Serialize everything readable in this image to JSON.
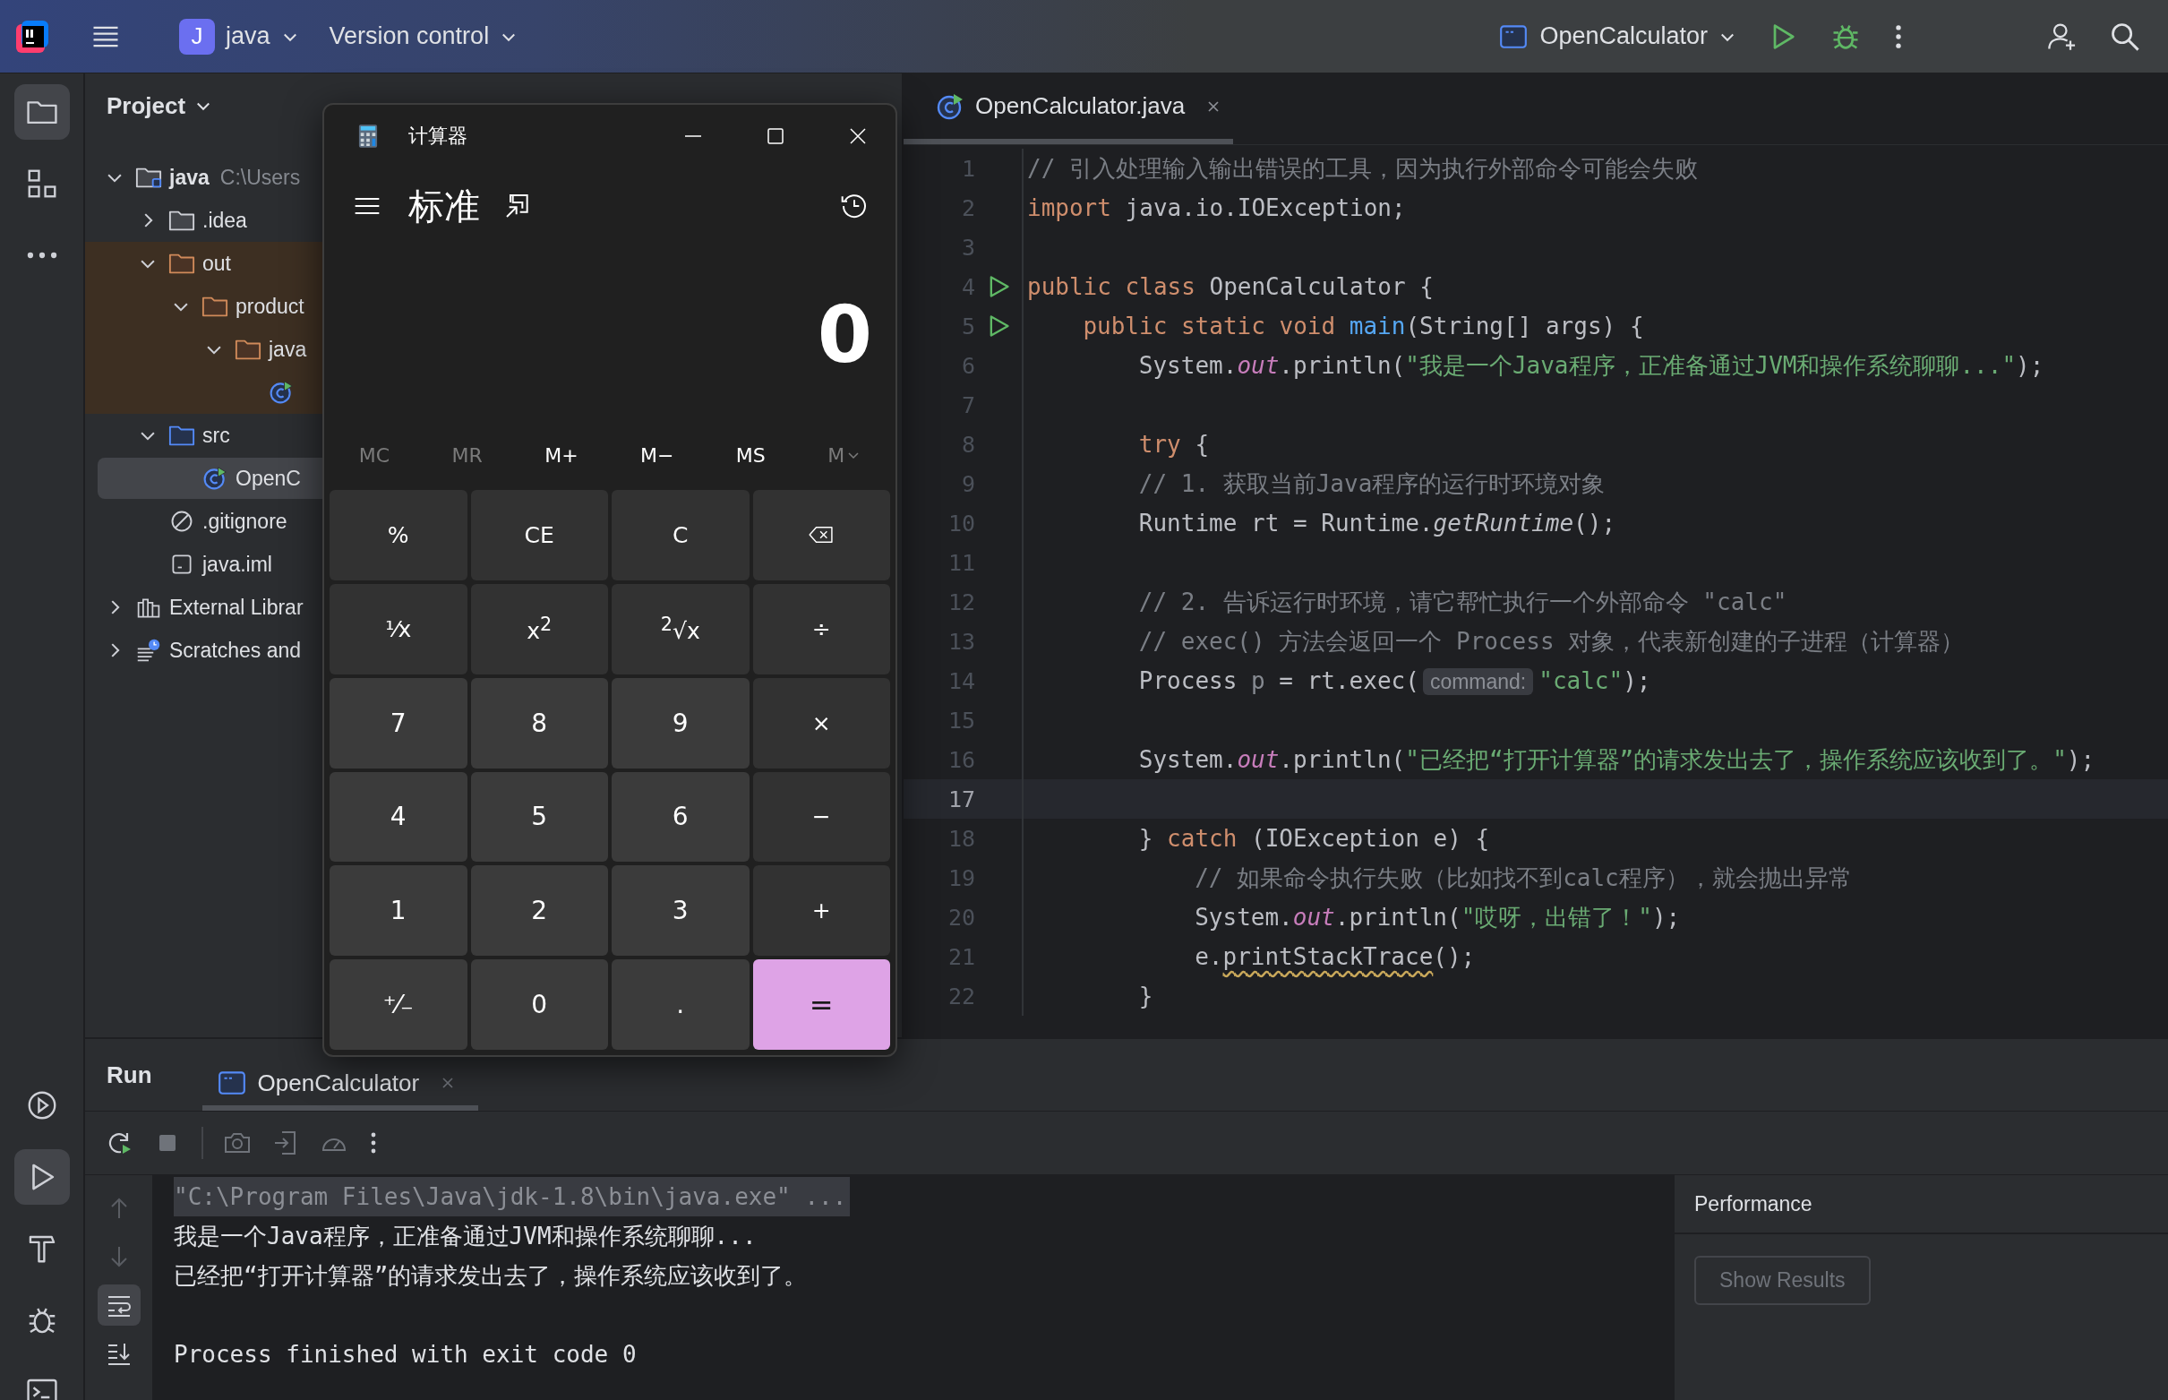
{
  "topbar": {
    "project": {
      "badge": "J",
      "name": "java"
    },
    "vcs": "Version control",
    "run_config": "OpenCalculator"
  },
  "tool_strip": {
    "top": [
      {
        "kind": "project",
        "selected": true
      },
      {
        "kind": "structure",
        "selected": false
      },
      {
        "kind": "more",
        "selected": false
      }
    ],
    "bottom": [
      {
        "kind": "services",
        "selected": false
      },
      {
        "kind": "run",
        "selected": true
      },
      {
        "kind": "build",
        "selected": false
      },
      {
        "kind": "debug",
        "selected": false
      },
      {
        "kind": "terminal",
        "selected": false
      }
    ]
  },
  "project": {
    "title": "Project",
    "tree": [
      {
        "name": "java",
        "path": "C:\\Users",
        "kind": "module",
        "expanded": true,
        "selected": false,
        "children": [
          {
            "name": ".idea",
            "kind": "folder",
            "expanded": false,
            "selected": false
          },
          {
            "name": "out",
            "kind": "excluded",
            "expanded": true,
            "selected": false,
            "children": [
              {
                "name": "product",
                "kind": "excluded",
                "expanded": true,
                "selected": false,
                "children": [
                  {
                    "name": "java",
                    "kind": "excluded",
                    "expanded": true,
                    "selected": false,
                    "children": [
                      {
                        "kind": "class",
                        "selected": false
                      }
                    ]
                  }
                ]
              }
            ]
          },
          {
            "name": "src",
            "kind": "source",
            "expanded": true,
            "selected": false,
            "children": [
              {
                "name": "OpenC",
                "kind": "class",
                "selected": true
              }
            ]
          },
          {
            "name": ".gitignore",
            "kind": "ignore",
            "selected": false
          },
          {
            "name": "java.iml",
            "kind": "iml",
            "selected": false
          }
        ]
      },
      {
        "name": "External Librar",
        "kind": "libraries",
        "expanded": false,
        "selected": false
      },
      {
        "name": "Scratches and",
        "kind": "scratches",
        "expanded": false,
        "selected": false
      }
    ]
  },
  "calculator": {
    "title": "计算器",
    "mode": "标准",
    "display": "0",
    "memory": [
      {
        "label": "MC",
        "kind": "plain",
        "disabled": true
      },
      {
        "label": "MR",
        "kind": "plain",
        "disabled": true
      },
      {
        "label": "M+",
        "kind": "plain",
        "disabled": false
      },
      {
        "label": "M−",
        "kind": "plain",
        "disabled": false
      },
      {
        "label": "MS",
        "kind": "plain",
        "disabled": false
      },
      {
        "label": "M",
        "kind": "dropdown",
        "disabled": true
      }
    ],
    "keys": [
      {
        "label": "%",
        "kind": "op"
      },
      {
        "label": "CE",
        "kind": "op"
      },
      {
        "label": "C",
        "kind": "op"
      },
      {
        "kind": "backspace"
      },
      {
        "label": "¹⁄x",
        "kind": "op"
      },
      {
        "label": "x$^{2}$",
        "kind": "op"
      },
      {
        "label": "$^{2}$√x",
        "kind": "op"
      },
      {
        "label": "÷",
        "kind": "op"
      },
      {
        "label": "7",
        "kind": "digit"
      },
      {
        "label": "8",
        "kind": "digit"
      },
      {
        "label": "9",
        "kind": "digit"
      },
      {
        "label": "×",
        "kind": "op"
      },
      {
        "label": "4",
        "kind": "digit"
      },
      {
        "label": "5",
        "kind": "digit"
      },
      {
        "label": "6",
        "kind": "digit"
      },
      {
        "label": "−",
        "kind": "op"
      },
      {
        "label": "1",
        "kind": "digit"
      },
      {
        "label": "2",
        "kind": "digit"
      },
      {
        "label": "3",
        "kind": "digit"
      },
      {
        "label": "+",
        "kind": "op"
      },
      {
        "label": "⁺⁄₋",
        "kind": "digit"
      },
      {
        "label": "0",
        "kind": "digit"
      },
      {
        "label": ".",
        "kind": "digit"
      },
      {
        "label": "=",
        "kind": "accent"
      }
    ]
  },
  "editor": {
    "tabs": [
      {
        "label": "OpenCalculator.java",
        "selected": true
      }
    ],
    "lines": [
      {
        "number": "1",
        "run": false,
        "current": false,
        "tokens": [
          {
            "kind": "comment",
            "text": "// 引入处理输入输出错误的工具，因为执行外部命令可能会失败"
          }
        ]
      },
      {
        "number": "2",
        "run": false,
        "current": false,
        "tokens": [
          {
            "kind": "kw",
            "text": "import "
          },
          {
            "kind": "plain",
            "text": "java.io.IOException;"
          }
        ]
      },
      {
        "number": "3",
        "run": false,
        "current": false
      },
      {
        "number": "4",
        "run": true,
        "current": false,
        "tokens": [
          {
            "kind": "kw",
            "text": "public class "
          },
          {
            "kind": "plain",
            "text": "OpenCalculator {"
          }
        ]
      },
      {
        "number": "5",
        "run": true,
        "current": false,
        "tokens": [
          {
            "kind": "kw",
            "text": "    public static void "
          },
          {
            "kind": "decl",
            "text": "main"
          },
          {
            "kind": "plain",
            "text": "(String[] args) {"
          }
        ]
      },
      {
        "number": "6",
        "run": false,
        "current": false,
        "tokens": [
          {
            "kind": "plain",
            "text": "        System."
          },
          {
            "kind": "field",
            "text": "out"
          },
          {
            "kind": "plain",
            "text": ".println("
          },
          {
            "kind": "str",
            "text": "\"我是一个Java程序，正准备通过JVM和操作系统聊聊...\""
          },
          {
            "kind": "plain",
            "text": ");"
          }
        ]
      },
      {
        "number": "7",
        "run": false,
        "current": false
      },
      {
        "number": "8",
        "run": false,
        "current": false,
        "tokens": [
          {
            "kind": "kw",
            "text": "        try"
          },
          {
            "kind": "plain",
            "text": " {"
          }
        ]
      },
      {
        "number": "9",
        "run": false,
        "current": false,
        "tokens": [
          {
            "kind": "comment",
            "text": "        // 1. 获取当前Java程序的运行时环境对象"
          }
        ]
      },
      {
        "number": "10",
        "run": false,
        "current": false,
        "tokens": [
          {
            "kind": "plain",
            "text": "        Runtime rt = Runtime."
          },
          {
            "kind": "static",
            "text": "getRuntime"
          },
          {
            "kind": "plain",
            "text": "();"
          }
        ]
      },
      {
        "number": "11",
        "run": false,
        "current": false
      },
      {
        "number": "12",
        "run": false,
        "current": false,
        "tokens": [
          {
            "kind": "comment",
            "text": "        // 2. 告诉运行时环境，请它帮忙执行一个外部命令 \"calc\""
          }
        ]
      },
      {
        "number": "13",
        "run": false,
        "current": false,
        "tokens": [
          {
            "kind": "comment",
            "text": "        // exec() 方法会返回一个 Process 对象，代表新创建的子进程（计算器）"
          }
        ]
      },
      {
        "number": "14",
        "run": false,
        "current": false,
        "tokens": [
          {
            "kind": "plain",
            "text": "        Process "
          },
          {
            "kind": "unused",
            "text": "p"
          },
          {
            "kind": "plain",
            "text": " = rt.exec("
          },
          {
            "kind": "hint",
            "text": "command:"
          },
          {
            "kind": "str",
            "text": "\"calc\""
          },
          {
            "kind": "plain",
            "text": ");"
          }
        ]
      },
      {
        "number": "15",
        "run": false,
        "current": false
      },
      {
        "number": "16",
        "run": false,
        "current": false,
        "tokens": [
          {
            "kind": "plain",
            "text": "        System."
          },
          {
            "kind": "field",
            "text": "out"
          },
          {
            "kind": "plain",
            "text": ".println("
          },
          {
            "kind": "str",
            "text": "\"已经把“打开计算器”的请求发出去了，操作系统应该收到了。\""
          },
          {
            "kind": "plain",
            "text": ");"
          }
        ]
      },
      {
        "number": "17",
        "run": false,
        "current": true
      },
      {
        "number": "18",
        "run": false,
        "current": false,
        "tokens": [
          {
            "kind": "plain",
            "text": "        } "
          },
          {
            "kind": "kw",
            "text": "catch"
          },
          {
            "kind": "plain",
            "text": " (IOException e) {"
          }
        ]
      },
      {
        "number": "19",
        "run": false,
        "current": false,
        "tokens": [
          {
            "kind": "comment",
            "text": "            // 如果命令执行失败（比如找不到calc程序），就会抛出异常"
          }
        ]
      },
      {
        "number": "20",
        "run": false,
        "current": false,
        "tokens": [
          {
            "kind": "plain",
            "text": "            System."
          },
          {
            "kind": "field",
            "text": "out"
          },
          {
            "kind": "plain",
            "text": ".println("
          },
          {
            "kind": "str",
            "text": "\"哎呀，出错了！\""
          },
          {
            "kind": "plain",
            "text": ");"
          }
        ]
      },
      {
        "number": "21",
        "run": false,
        "current": false,
        "tokens": [
          {
            "kind": "plain",
            "text": "            e."
          },
          {
            "kind": "warn",
            "text": "printStackTrace"
          },
          {
            "kind": "plain",
            "text": "();"
          }
        ]
      },
      {
        "number": "22",
        "run": false,
        "current": false,
        "tokens": [
          {
            "kind": "plain",
            "text": "        }"
          }
        ]
      }
    ]
  },
  "run": {
    "title": "Run",
    "tabs": [
      {
        "label": "OpenCalculator",
        "selected": true
      }
    ],
    "tools": [
      {
        "kind": "up",
        "selected": false
      },
      {
        "kind": "down",
        "selected": false
      },
      {
        "kind": "wrap",
        "selected": true
      },
      {
        "kind": "scroll-end",
        "selected": false
      }
    ],
    "console": [
      {
        "kind": "command",
        "text": "\"C:\\Program Files\\Java\\jdk-1.8\\bin\\java.exe\" ..."
      },
      {
        "kind": "output",
        "text": "我是一个Java程序，正准备通过JVM和操作系统聊聊..."
      },
      {
        "kind": "output",
        "text": "已经把“打开计算器”的请求发出去了，操作系统应该收到了。"
      },
      {
        "kind": "exit",
        "text": "Process finished with exit code 0"
      }
    ],
    "performance": {
      "title": "Performance",
      "button": {
        "label": "Show Results",
        "disabled": true
      }
    }
  }
}
